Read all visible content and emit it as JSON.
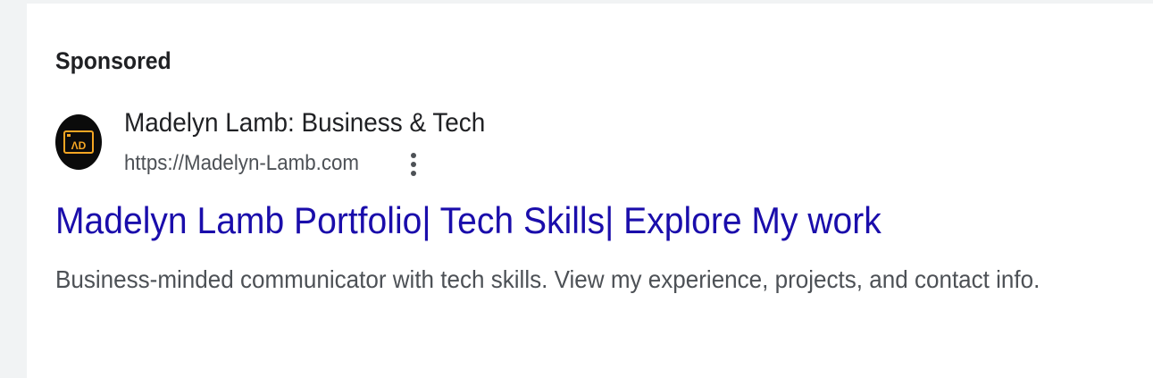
{
  "ad": {
    "label": "Sponsored",
    "advertiser": {
      "name": "Madelyn Lamb: Business & Tech",
      "url": "https://Madelyn-Lamb.com",
      "favicon_icon": "ad-logo-icon"
    },
    "more_icon": "more-vert-icon",
    "title": "Madelyn Lamb Portfolio| Tech Skills| Explore My work",
    "description": "Business-minded communicator with tech skills. View my experience, projects, and contact info."
  },
  "colors": {
    "title_link": "#1a0dab",
    "primary_text": "#202124",
    "secondary_text": "#4d5156",
    "favicon_bg": "#0b0b0b",
    "favicon_accent": "#f5a623"
  }
}
